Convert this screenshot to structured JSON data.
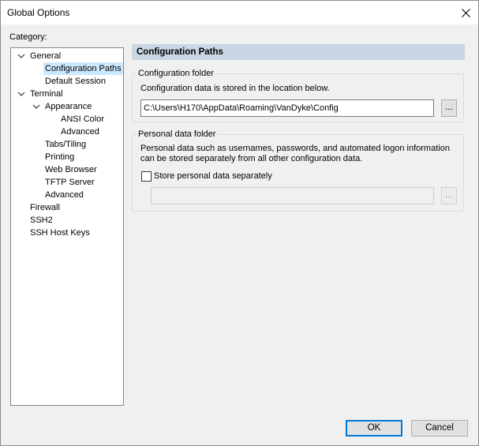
{
  "window": {
    "title": "Global Options"
  },
  "category": {
    "label": "Category:"
  },
  "tree": [
    {
      "label": "General",
      "level": 0,
      "expander": "expanded"
    },
    {
      "label": "Configuration Paths",
      "level": 1,
      "selected": true
    },
    {
      "label": "Default Session",
      "level": 1
    },
    {
      "label": "Terminal",
      "level": 0,
      "expander": "expanded"
    },
    {
      "label": "Appearance",
      "level": 1,
      "expander": "expanded"
    },
    {
      "label": "ANSI Color",
      "level": 2
    },
    {
      "label": "Advanced",
      "level": 2
    },
    {
      "label": "Tabs/Tiling",
      "level": 1
    },
    {
      "label": "Printing",
      "level": 1
    },
    {
      "label": "Web Browser",
      "level": 1
    },
    {
      "label": "TFTP Server",
      "level": 1
    },
    {
      "label": "Advanced",
      "level": 1
    },
    {
      "label": "Firewall",
      "level": 0
    },
    {
      "label": "SSH2",
      "level": 0
    },
    {
      "label": "SSH Host Keys",
      "level": 0
    }
  ],
  "panel": {
    "header": "Configuration Paths",
    "config_folder": {
      "title": "Configuration folder",
      "description": "Configuration data is stored in the location below.",
      "path": "C:\\Users\\H170\\AppData\\Roaming\\VanDyke\\Config",
      "browse_label": "..."
    },
    "personal_folder": {
      "title": "Personal data folder",
      "description_line1": "Personal data such as usernames, passwords, and automated logon information",
      "description_line2": "can be stored separately from all other configuration data.",
      "checkbox_label": "Store personal data separately",
      "checkbox_checked": false,
      "path": "",
      "browse_label": "..."
    }
  },
  "buttons": {
    "ok": "OK",
    "cancel": "Cancel"
  }
}
